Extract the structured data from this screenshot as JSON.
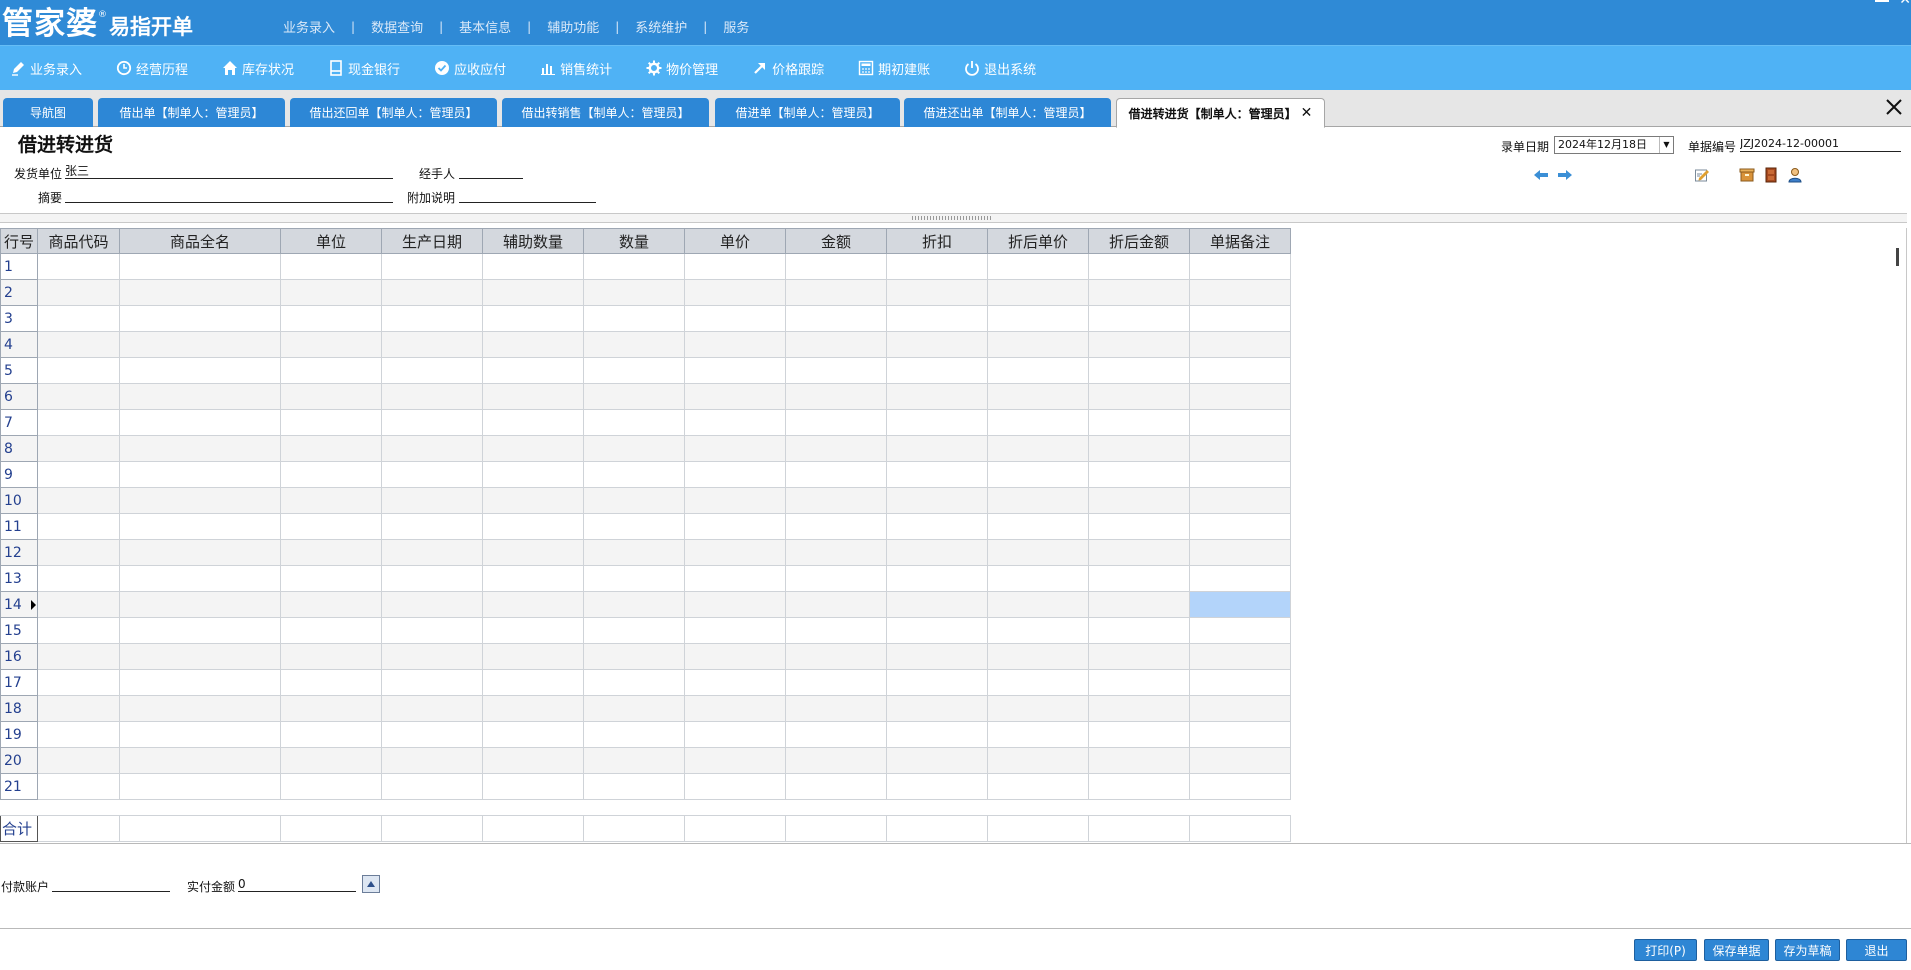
{
  "brand": {
    "main": "管家婆",
    "registered": "®",
    "sub": "易指开单"
  },
  "top_menu": [
    "业务录入",
    "数据查询",
    "基本信息",
    "辅助功能",
    "系统维护",
    "服务"
  ],
  "toolbar": {
    "items": [
      {
        "label": "业务录入",
        "icon": "pen-icon"
      },
      {
        "label": "经营历程",
        "icon": "clock-icon"
      },
      {
        "label": "库存状况",
        "icon": "house-icon"
      },
      {
        "label": "现金银行",
        "icon": "card-icon"
      },
      {
        "label": "应收应付",
        "icon": "check-circle-icon"
      },
      {
        "label": "销售统计",
        "icon": "bar-chart-icon"
      },
      {
        "label": "物价管理",
        "icon": "gear-icon"
      },
      {
        "label": "价格跟踪",
        "icon": "arrow-icon"
      },
      {
        "label": "期初建账",
        "icon": "calculator-icon"
      },
      {
        "label": "退出系统",
        "icon": "power-icon"
      }
    ]
  },
  "tabs": [
    {
      "label": "导航图"
    },
    {
      "label": "借出单【制单人：管理员】"
    },
    {
      "label": "借出还回单【制单人：管理员】"
    },
    {
      "label": "借出转销售【制单人：管理员】"
    },
    {
      "label": "借进单【制单人：管理员】"
    },
    {
      "label": "借进还出单【制单人：管理员】"
    },
    {
      "label": "借进转进货【制单人：管理员】",
      "close": "✕"
    }
  ],
  "form": {
    "title": "借进转进货",
    "supplier_label": "发货单位",
    "supplier_value": "张三",
    "handler_label": "经手人",
    "handler_value": "",
    "summary_label": "摘要",
    "summary_value": "",
    "note_label": "附加说明",
    "note_value": "",
    "date_label": "录单日期",
    "date_value": "2024年12月18日",
    "docno_label": "单据编号",
    "docno_value": "JZJ2024-12-00001"
  },
  "grid": {
    "columns": [
      "行号",
      "商品代码",
      "商品全名",
      "单位",
      "生产日期",
      "辅助数量",
      "数量",
      "单价",
      "金额",
      "折扣",
      "折后单价",
      "折后金额",
      "单据备注"
    ],
    "rows": [
      "1",
      "2",
      "3",
      "4",
      "5",
      "6",
      "7",
      "8",
      "9",
      "10",
      "11",
      "12",
      "13",
      "14",
      "15",
      "16",
      "17",
      "18",
      "19",
      "20",
      "21"
    ],
    "current_row": "14",
    "total_label": "合计"
  },
  "footer": {
    "account_label": "付款账户",
    "account_value": "",
    "paid_label": "实付金额",
    "paid_value": "0"
  },
  "buttons": {
    "print": "打印(P)",
    "save": "保存单据",
    "draft": "存为草稿",
    "exit": "退出"
  }
}
